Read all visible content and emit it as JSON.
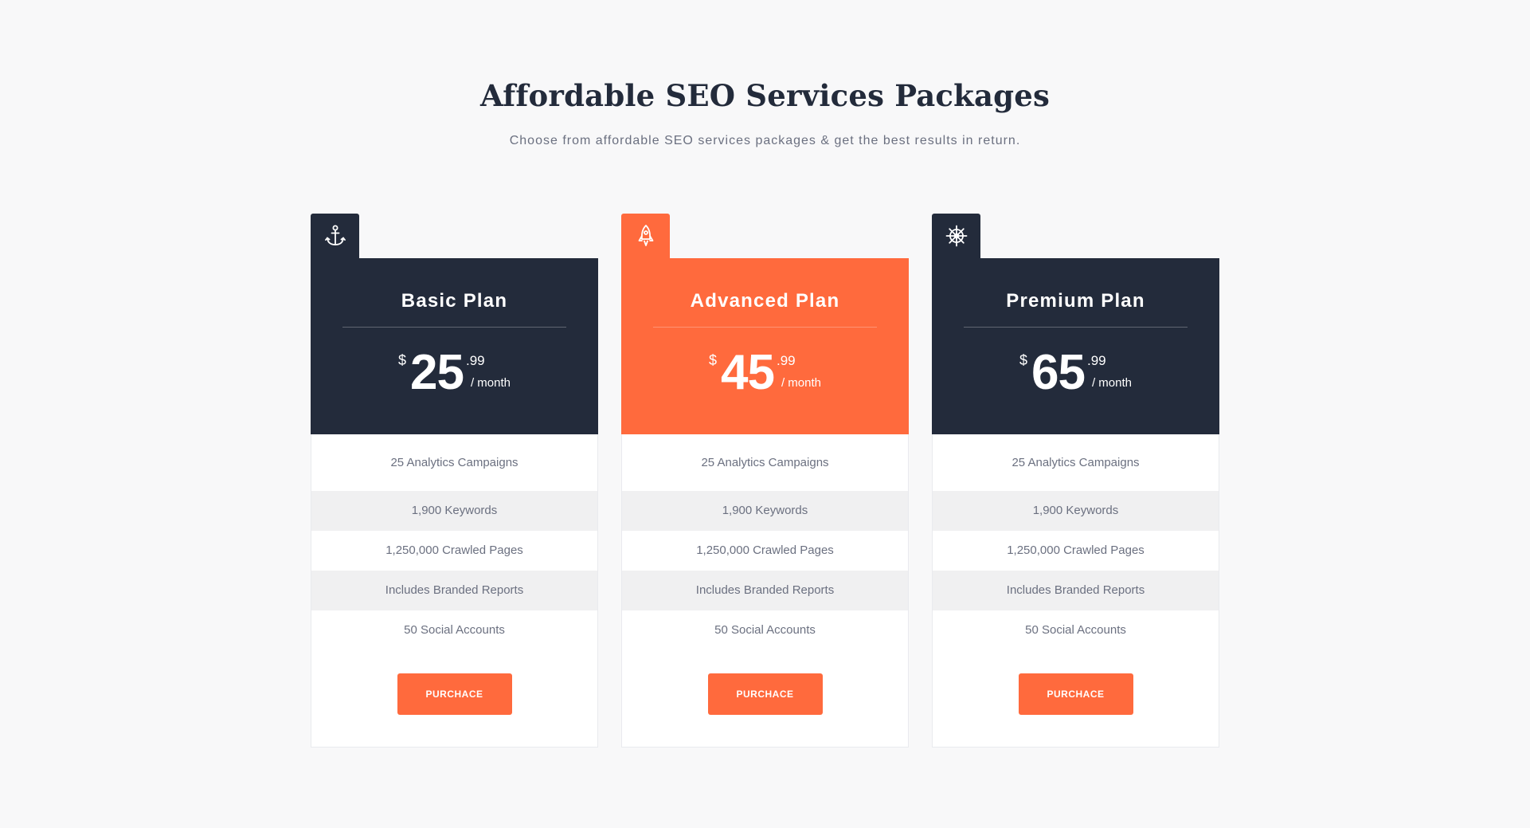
{
  "header": {
    "title": "Affordable SEO Services Packages",
    "subtitle": "Choose from affordable SEO services packages & get the best results in return."
  },
  "colors": {
    "dark": "#232b3b",
    "accent": "#ff6a3d",
    "background": "#f8f8f9"
  },
  "plans": [
    {
      "icon": "anchor-icon",
      "name": "Basic Plan",
      "currency": "$",
      "amount": "25",
      "cents": ".99",
      "period": "/ month",
      "features": [
        "25 Analytics Campaigns",
        "1,900 Keywords",
        "1,250,000 Crawled Pages",
        "Includes Branded Reports",
        "50 Social Accounts"
      ],
      "button": "PURCHACE"
    },
    {
      "icon": "rocket-icon",
      "name": "Advanced Plan",
      "currency": "$",
      "amount": "45",
      "cents": ".99",
      "period": "/ month",
      "features": [
        "25 Analytics Campaigns",
        "1,900 Keywords",
        "1,250,000 Crawled Pages",
        "Includes Branded Reports",
        "50 Social Accounts"
      ],
      "button": "PURCHACE"
    },
    {
      "icon": "ship-wheel-icon",
      "name": "Premium Plan",
      "currency": "$",
      "amount": "65",
      "cents": ".99",
      "period": "/ month",
      "features": [
        "25 Analytics Campaigns",
        "1,900 Keywords",
        "1,250,000 Crawled Pages",
        "Includes Branded Reports",
        "50 Social Accounts"
      ],
      "button": "PURCHACE"
    }
  ]
}
